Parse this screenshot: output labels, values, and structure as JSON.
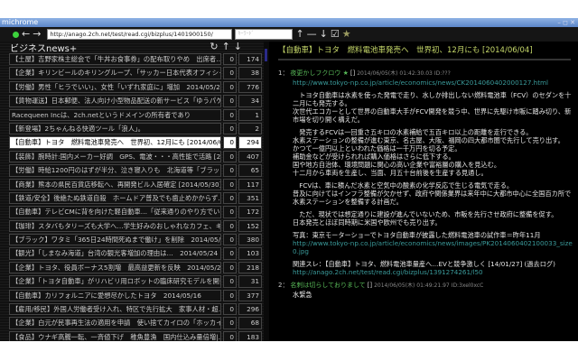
{
  "window": {
    "title": "michrome",
    "controls": "– ◻ ✕"
  },
  "toolbar": {
    "url": "http://anago.2ch.net/test/read.cgi/bizplus/1401900150/",
    "search_placeholder": "ｷｰﾜｰﾄﾞ",
    "status_color": "#3dd23d"
  },
  "board": {
    "title": "ビジネスnews+",
    "threads": [
      {
        "title": "【土屋】吉野家株主総会で「牛丼お食事券」の配布取りやめ　出席者…",
        "new": "0",
        "count": "174"
      },
      {
        "title": "【企業】キリンビールのキリングループ、「サッカー日本代表オフィシャル…",
        "new": "0",
        "count": "38"
      },
      {
        "title": "【労働】男性「ヒラでいい」、女性「いずれ家庭に」増加　2014/05/21",
        "new": "0",
        "count": "776"
      },
      {
        "title": "【貨物運送】日本郵便、法人向け小型物品配送の新サービス「ゆうパケ…",
        "new": "0",
        "count": "34"
      },
      {
        "title": "Racequeen Incは、2ch.netというドメインの所有者であり",
        "new": "0",
        "count": "1"
      },
      {
        "title": "【新登場】2ちゃんねる快適ツール「浪人」。",
        "new": "0",
        "count": "2"
      },
      {
        "title": "【自動車】トヨタ　燃料電池車発売へ　世界初、12月にも [2014/06/04]",
        "new": "0",
        "count": "294",
        "selected": true
      },
      {
        "title": "【装飾】腕時計:国内メーカー好調　GPS、電波・・・高性能で活路 [201…",
        "new": "0",
        "count": "407"
      },
      {
        "title": "【労働】時給1200円のはずが半分、泣き寝入りも　北海道等「ブラック…",
        "new": "0",
        "count": "65"
      },
      {
        "title": "【商業】熊本の県民百貨店移転へ、再開発ビル入居確定 [2014/05/30]",
        "new": "0",
        "count": "117"
      },
      {
        "title": "【鉄道/安全】後絶たぬ鉄道自殺　ホームドア普及でも歯止めかからず…",
        "new": "0",
        "count": "351"
      },
      {
        "title": "【自動車】テレビCMに背を向けた軽自動車…「従来通りのやり方でい…",
        "new": "0",
        "count": "172"
      },
      {
        "title": "【珈琲】スタバもタリーズも大学へ…学生好みのおしゃれなカフェ、キャン…",
        "new": "0",
        "count": "152"
      },
      {
        "title": "【ブラック】ワタミ「365日24時間死ぬまで働け」を削除　2014/05/21",
        "new": "0",
        "count": "380"
      },
      {
        "title": "【観光】「しまなみ海道」台湾の観光客増加の理由は…　2014/05/24",
        "new": "0",
        "count": "103"
      },
      {
        "title": "【企業】トヨタ、役員ボーナス5割増　最高益更新を反映　2014/05/28",
        "new": "0",
        "count": "218"
      },
      {
        "title": "【企業】「トヨタ自動車」がリハビリ用ロボットの臨床研究モデルを開発…",
        "new": "0",
        "count": "31"
      },
      {
        "title": "【自動車】カリフォルニアに愛想尽かしたトヨタ　2014/05/16",
        "new": "0",
        "count": "377"
      },
      {
        "title": "【雇用/移民】外国人労働者受け入れ、特区で先行拡大　家事人材・超…",
        "new": "0",
        "count": "296"
      },
      {
        "title": "【企業】白元が民事再生法の適用を申請　使い捨てカイロの「ホッカイ…",
        "new": "0",
        "count": "68"
      },
      {
        "title": "【食品】ウナギ高騰一転、一斉値下げ　稚魚豊漁　国内仕込み量倍増|…",
        "new": "0",
        "count": "183"
      }
    ]
  },
  "thread": {
    "title": "【自動車】トヨタ　燃料電池車発売へ　世界初、12月にも [2014/06/04]",
    "posts": [
      {
        "num": "1：",
        "name": "夜更かしフクロウ ★",
        "mail": "[]",
        "date": "2014/06/05(木) 01:42:30.03",
        "id": "ID:???",
        "link1": "http://www.tokyo-np.co.jp/article/economics/news/CK2014060402000127.html",
        "p1": [
          "　トヨタ自動車は水素を使った発電で走り、水しか排出しない燃料電池車（FCV）のセダンを十二月にも発売する。",
          "次世代エコカーとして世界の自動車大手がFCV開発を競う中、世界に先駆け市販に踏み切り、新市場を切り開く構えだ。"
        ],
        "p2": [
          "　発売するFCVは一回重さ五キロの水素補給で五百キロ以上の距離を走行できる。",
          "水素ステーションの整備が進む東京、名古屋、大阪、福岡の四大都市圏で先行して売り出す。",
          "かつて一億円以上といわれた価格は一千万円を切る予定。",
          "補助金などが受けられれば購入価格はさらに低下する。",
          "国や地方自治体、環境問題に関心の高い企業や富裕層の購入を見込む。",
          "十二月から車両を生産し、当面、月五十台前後を生産する見通し。"
        ],
        "p3": [
          "　FCVは、車に積んだ水素と空気中の酸素の化学反応で生じる電気で走る。",
          "普及に向けてはインフラ整備が欠かせず、政府や関係業界は来年中に大都市中心に全国百カ所で水素ステーションを整備する計画だ。"
        ],
        "p4": [
          "　ただ、現状では想定通りに建設が進んでいないため、市販を先行させ政府に整備を促す。",
          "日本発売とほぼ同時期に米国や欧州でも売り出す。"
        ],
        "photo": "写真：東京モーターショーでトヨタ自動車が披露した燃料電池車の試作車＝昨年11月",
        "photo_link": "http://www.tokyo-np.co.jp/article/economics/news/images/PK2014060402100033_size0.jpg",
        "related": "関連スレ：【自動車】トヨタ、燃料電池車量産へ…EVと競争激しく [14/01/27] (過去ログ)",
        "related_link": "http://anago.2ch.net/test/read.cgi/bizplus/1391274261/l50"
      },
      {
        "num": "2：",
        "name": "名刺は切らしておりまして",
        "mail": "[]",
        "date": "2014/06/05(木) 01:49:21.97",
        "id": "ID:3xel0xcC",
        "body": "水緊急"
      }
    ]
  }
}
